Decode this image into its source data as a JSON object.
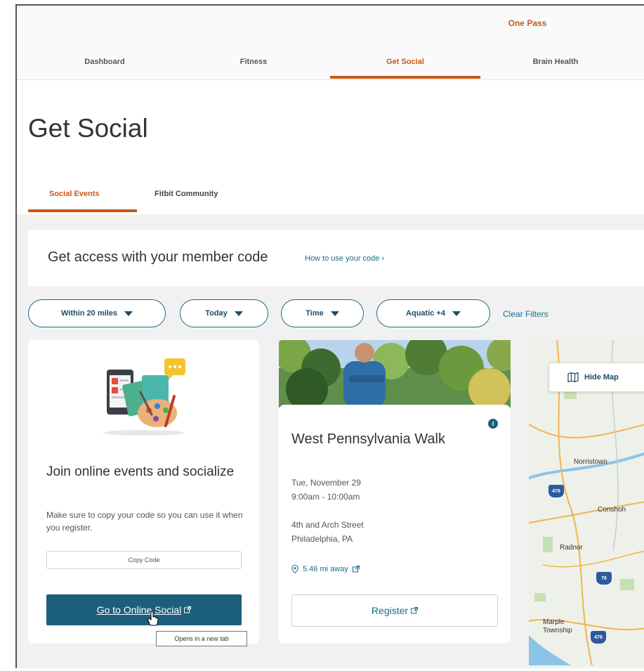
{
  "brand": "One Pass",
  "nav": {
    "tabs": [
      "Dashboard",
      "Fitness",
      "Get Social",
      "Brain Health"
    ],
    "active": "Get Social"
  },
  "page_title": "Get Social",
  "subtabs": {
    "items": [
      "Social Events",
      "Fitbit Community"
    ],
    "active": "Social Events"
  },
  "member_banner": {
    "text": "Get access with your member code",
    "link": "How to use your code ›"
  },
  "filters": {
    "chips": [
      "Within 20 miles",
      "Today",
      "Time",
      "Aquatic +4"
    ],
    "clear": "Clear Filters"
  },
  "online_card": {
    "heading": "Join online events and socialize",
    "description": "Make sure to copy your code so you can use it when you register.",
    "copy_button": "Copy Code",
    "go_button": "Go to Online Social",
    "tooltip": "Opens in a new tab"
  },
  "event_card": {
    "title": "West Pennsylvania Walk",
    "date": "Tue, November 29",
    "time": "9:00am - 10:00am",
    "address_line1": "4th and Arch Street",
    "address_line2": "Philadelphia, PA",
    "distance": "5.46 mi away",
    "register": "Register",
    "info": "i"
  },
  "map": {
    "hide_button": "Hide Map",
    "labels": [
      "Norristown",
      "Conshoh",
      "Radnor",
      "Marple Township"
    ],
    "highway_shields": [
      "476",
      "76",
      "476"
    ]
  },
  "colors": {
    "accent": "#c8581a",
    "primary": "#1c5f7c",
    "link": "#1c6b8f"
  }
}
